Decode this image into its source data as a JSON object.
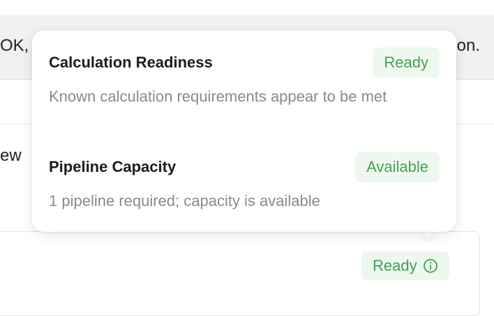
{
  "background": {
    "banner_left_text": "OK, g",
    "banner_right_text": "on.",
    "card_text": "ew"
  },
  "status_chip": {
    "label": "Ready",
    "icon": "info-circle-icon"
  },
  "popover": {
    "sections": [
      {
        "title": "Calculation Readiness",
        "badge": "Ready",
        "description": "Known calculation requirements appear to be met"
      },
      {
        "title": "Pipeline Capacity",
        "badge": "Available",
        "description": "1 pipeline required; capacity is available"
      }
    ]
  },
  "colors": {
    "success_text": "#45a059",
    "success_bg": "#eff8ef",
    "muted_text": "#8a8a8a",
    "banner_bg": "#f1f1f1"
  }
}
